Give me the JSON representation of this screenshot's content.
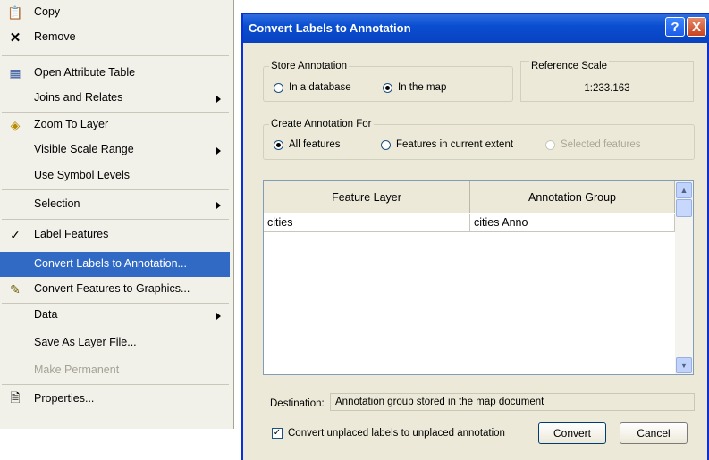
{
  "menu": {
    "items": [
      {
        "label": "Copy",
        "icon": "📋"
      },
      {
        "label": "Remove",
        "icon": "✕"
      },
      {
        "label": "Open Attribute Table",
        "icon": "▦"
      },
      {
        "label": "Joins and Relates"
      },
      {
        "label": "Zoom To Layer",
        "icon": "◈"
      },
      {
        "label": "Visible Scale Range"
      },
      {
        "label": "Use Symbol Levels"
      },
      {
        "label": "Selection"
      },
      {
        "label": "Label Features",
        "icon": "✓"
      },
      {
        "label": "Convert Labels to Annotation..."
      },
      {
        "label": "Convert Features to Graphics...",
        "icon": "✎"
      },
      {
        "label": "Data"
      },
      {
        "label": "Save As Layer File..."
      },
      {
        "label": "Make Permanent"
      },
      {
        "label": "Properties...",
        "icon": "🗎"
      }
    ]
  },
  "dialog": {
    "title": "Convert Labels to Annotation",
    "help_label": "?",
    "close_label": "X",
    "store": {
      "legend": "Store Annotation",
      "opt_database": "In a database",
      "opt_map": "In the map"
    },
    "reference_scale": {
      "label": "Reference Scale",
      "value": "1:233.163"
    },
    "create_for": {
      "legend": "Create Annotation For",
      "opt_all": "All features",
      "opt_extent": "Features in current extent",
      "opt_selected": "Selected features"
    },
    "table": {
      "headers": [
        "Feature Layer",
        "Annotation Group"
      ],
      "rows": [
        [
          "cities",
          "cities Anno"
        ]
      ]
    },
    "destination": {
      "label": "Destination:",
      "value": "Annotation group stored in the map document"
    },
    "checkbox_label": "Convert unplaced labels to unplaced annotation",
    "convert_label": "Convert",
    "cancel_label": "Cancel"
  }
}
